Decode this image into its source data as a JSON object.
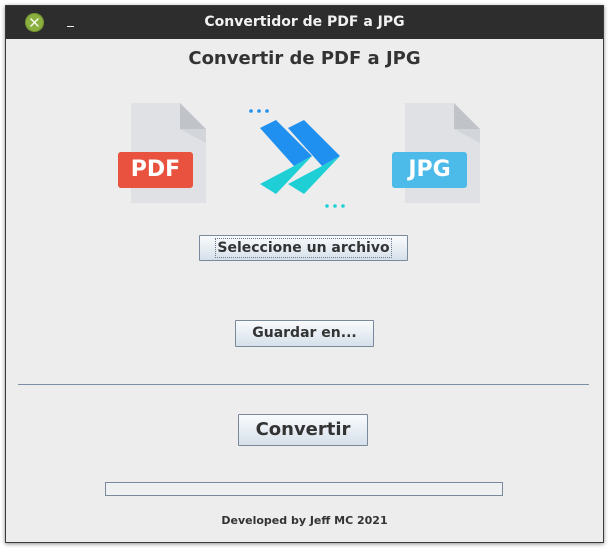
{
  "window": {
    "title": "Convertidor de PDF a JPG",
    "controls": {
      "close_icon": "close-icon",
      "minimize_icon": "minimize-icon"
    }
  },
  "main": {
    "heading": "Convertir de PDF a JPG",
    "illustration": {
      "source_label": "PDF",
      "target_label": "JPG",
      "source_icon": "pdf-file-icon",
      "arrow_icon": "double-chevron-arrow-icon",
      "target_icon": "jpg-file-icon",
      "colors": {
        "pdf_tag": "#e8523f",
        "jpg_tag": "#4dbbe9",
        "arrow_blue": "#1f8ff0",
        "arrow_teal": "#1fcfd6"
      }
    },
    "select_file_label": "Seleccione un archivo",
    "save_to_label": "Guardar en...",
    "convert_label": "Convertir",
    "progress": {
      "value": 0
    },
    "footer": "Developed by Jeff MC 2021"
  },
  "colors": {
    "window_background": "#ededed",
    "titlebar_background": "#2d2d2d",
    "close_button": "#8bb040",
    "separator": "#7c8ea5"
  }
}
